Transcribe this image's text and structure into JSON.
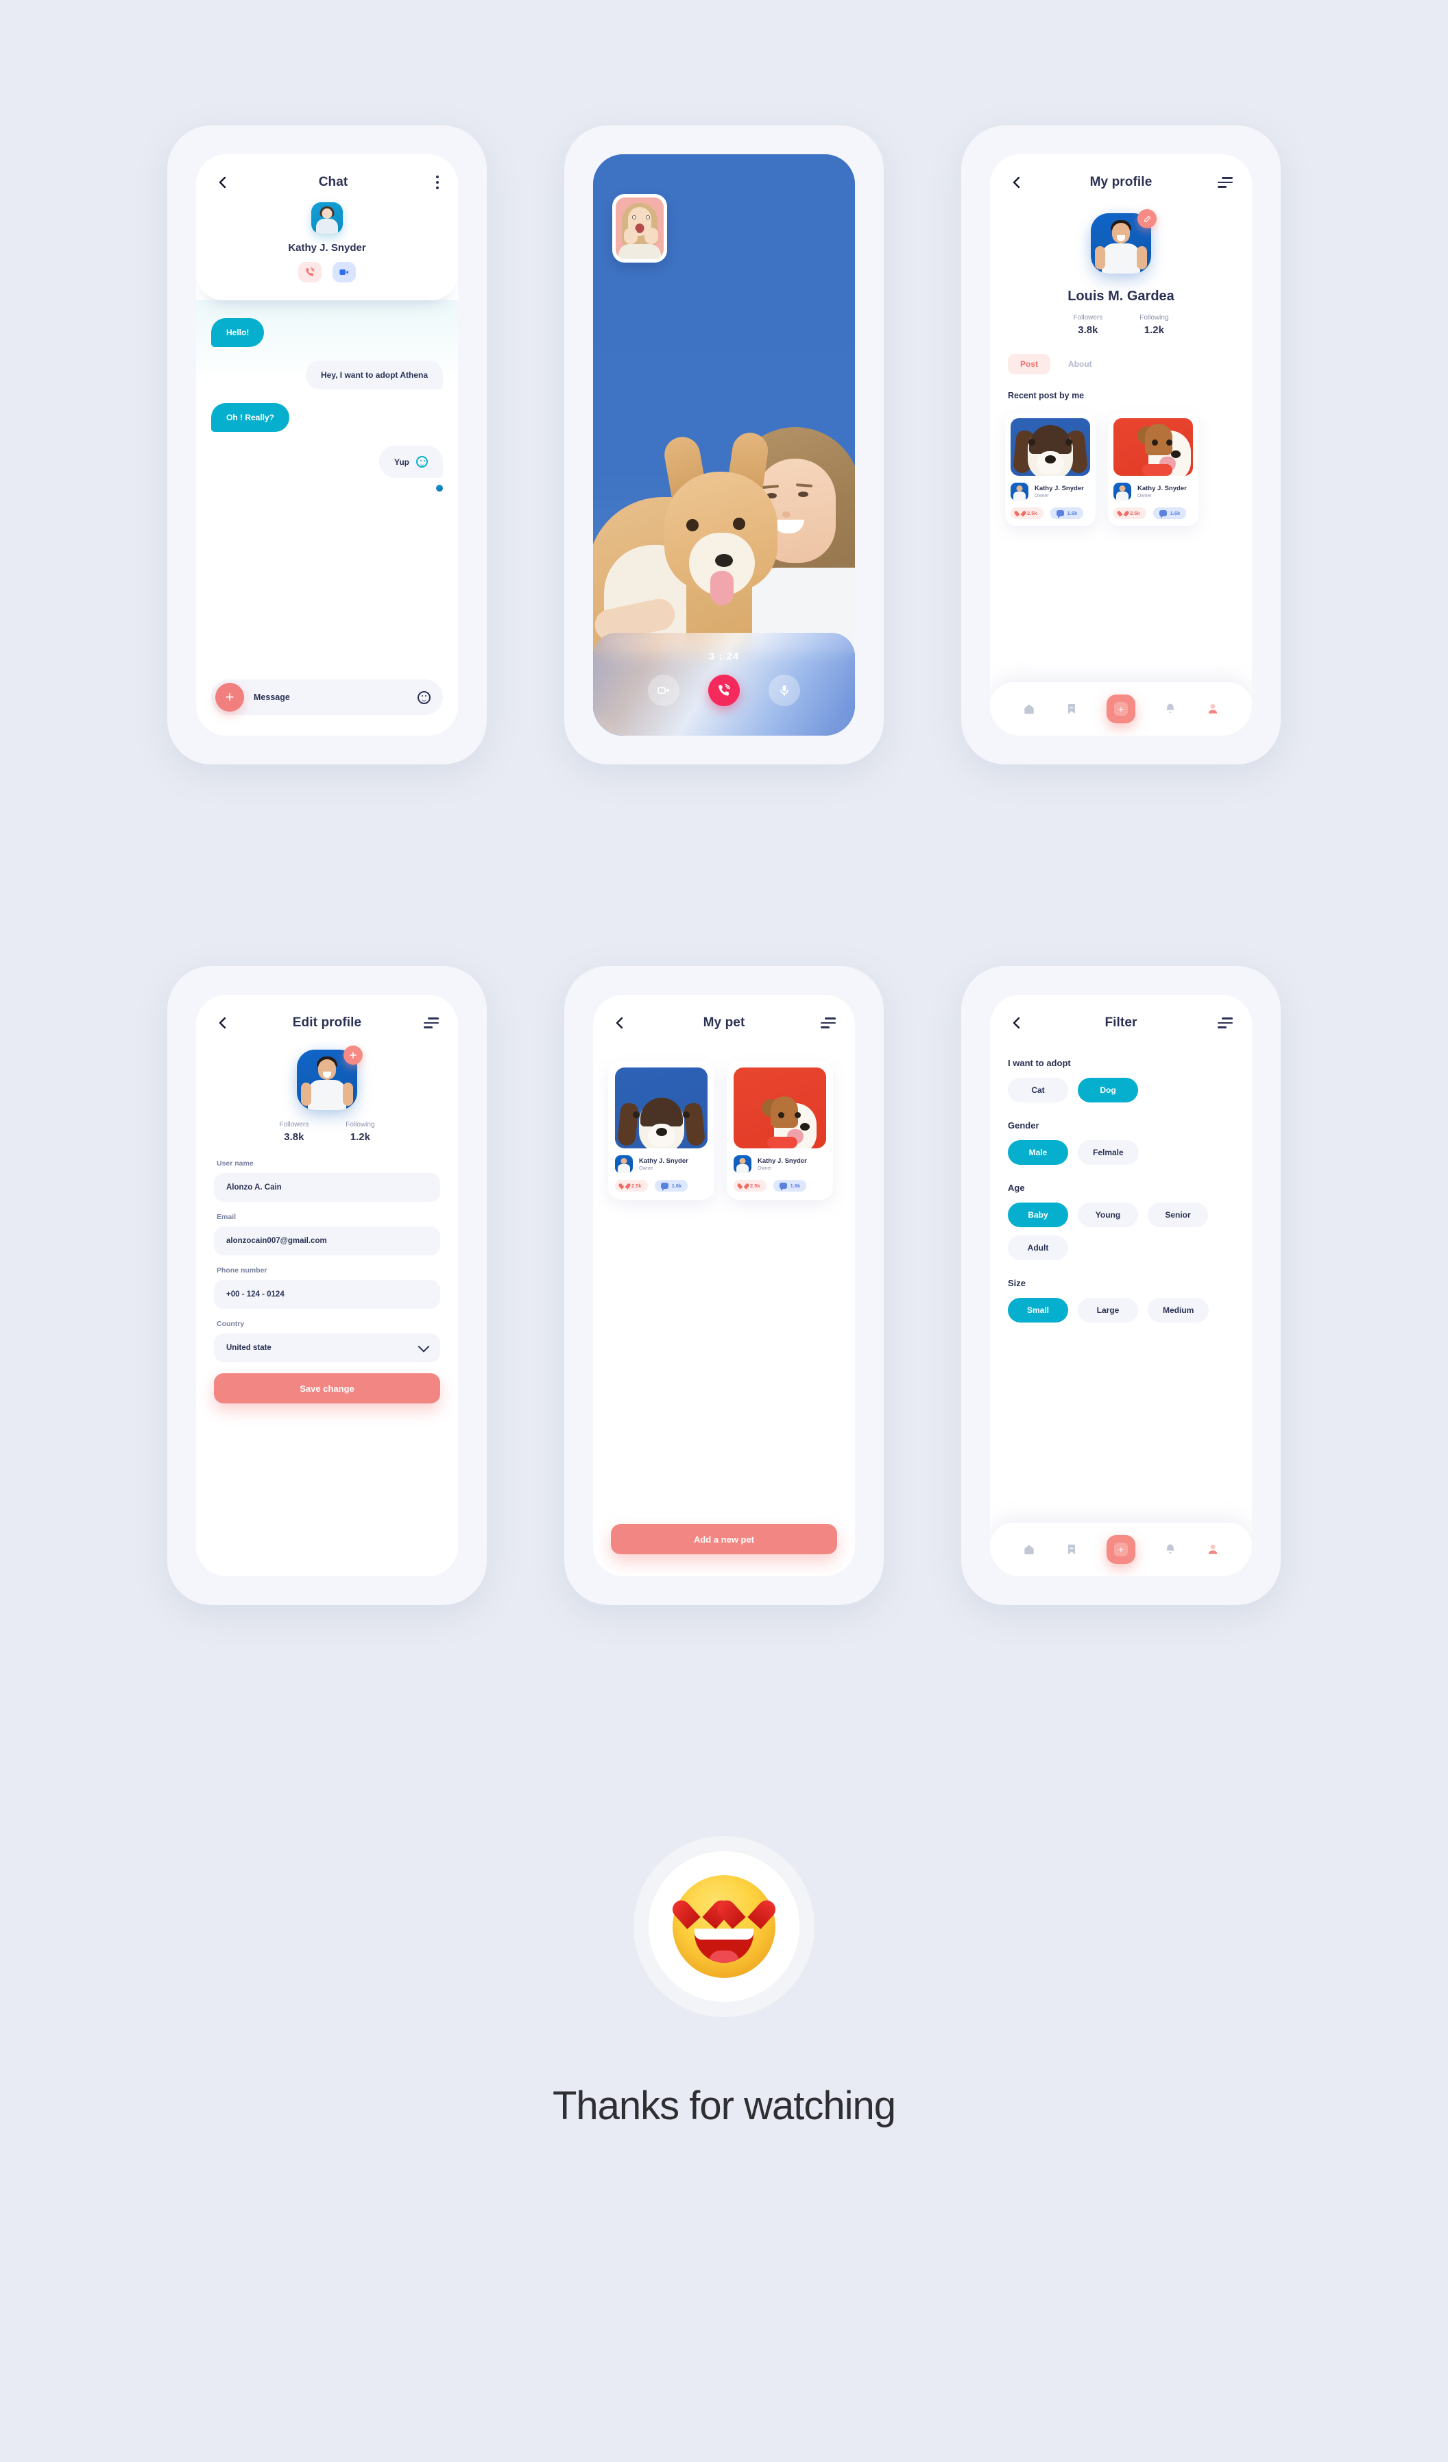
{
  "meta": {
    "footer_text": "Thanks for watching",
    "emoji": "heart-eyes-emoji"
  },
  "chat_screen": {
    "title": "Chat",
    "back_icon": "chevron-left-icon",
    "more_icon": "more-vertical-icon",
    "contact_name": "Kathy J. Snyder",
    "call_icon": "phone-call-icon",
    "video_icon": "video-camera-icon",
    "messages": [
      {
        "text": "Hello!",
        "side": "out"
      },
      {
        "text": "Hey, I want to adopt Athena",
        "side": "in"
      },
      {
        "text": "Oh ! Really?",
        "side": "out"
      },
      {
        "text": "Yup",
        "side": "in",
        "emoji": "smiley-icon"
      }
    ],
    "input_placeholder": "Message",
    "attach_icon": "plus-icon",
    "emoji_icon": "smiley-icon"
  },
  "video_call_screen": {
    "timer": "3 : 24",
    "pip_label": "self-view",
    "controls": [
      {
        "name": "video-toggle-button",
        "icon": "video-camera-icon"
      },
      {
        "name": "end-call-button",
        "icon": "phone-hangup-icon"
      },
      {
        "name": "mic-toggle-button",
        "icon": "microphone-icon"
      }
    ]
  },
  "profile_screen": {
    "title": "My profile",
    "back_icon": "chevron-left-icon",
    "menu_icon": "filter-slider-icon",
    "edit_badge_icon": "pencil-icon",
    "name": "Louis M. Gardea",
    "stats": [
      {
        "label": "Followers",
        "value": "3.8k"
      },
      {
        "label": "Following",
        "value": "1.2k"
      }
    ],
    "tabs": [
      {
        "label": "Post",
        "active": true
      },
      {
        "label": "About",
        "active": false
      }
    ],
    "section_title": "Recent post by me",
    "posts": [
      {
        "owner": "Kathy J. Snyder",
        "role": "Owner",
        "likes": "2.5k",
        "comments": "1.6k",
        "bg": "blue"
      },
      {
        "owner": "Kathy J. Snyder",
        "role": "Owner",
        "likes": "2.5k",
        "comments": "1.6k",
        "bg": "red"
      }
    ]
  },
  "edit_profile_screen": {
    "title": "Edit profile",
    "back_icon": "chevron-left-icon",
    "menu_icon": "filter-slider-icon",
    "add_badge_icon": "plus-icon",
    "stats": [
      {
        "label": "Followers",
        "value": "3.8k"
      },
      {
        "label": "Following",
        "value": "1.2k"
      }
    ],
    "fields": [
      {
        "label": "User name",
        "value": "Alonzo A. Cain",
        "type": "text"
      },
      {
        "label": "Email",
        "value": "alonzocain007@gmail.com",
        "type": "text"
      },
      {
        "label": "Phone number",
        "value": "+00 - 124 - 0124",
        "type": "text"
      },
      {
        "label": "Country",
        "value": "United state",
        "type": "select"
      }
    ],
    "save_label": "Save change"
  },
  "my_pet_screen": {
    "title": "My pet",
    "back_icon": "chevron-left-icon",
    "menu_icon": "filter-slider-icon",
    "pets": [
      {
        "owner": "Kathy J. Snyder",
        "role": "Owner",
        "likes": "2.5k",
        "comments": "1.6k",
        "bg": "blue"
      },
      {
        "owner": "Kathy J. Snyder",
        "role": "Owner",
        "likes": "2.5k",
        "comments": "1.6k",
        "bg": "red"
      }
    ],
    "add_label": "Add a new pet"
  },
  "filter_screen": {
    "title": "Filter",
    "back_icon": "chevron-left-icon",
    "menu_icon": "filter-slider-icon",
    "groups": [
      {
        "title": "I want to adopt",
        "options": [
          {
            "label": "Cat",
            "selected": false
          },
          {
            "label": "Dog",
            "selected": true
          }
        ]
      },
      {
        "title": "Gender",
        "options": [
          {
            "label": "Male",
            "selected": true
          },
          {
            "label": "Felmale",
            "selected": false
          }
        ]
      },
      {
        "title": "Age",
        "options": [
          {
            "label": "Baby",
            "selected": true
          },
          {
            "label": "Young",
            "selected": false
          },
          {
            "label": "Senior",
            "selected": false
          },
          {
            "label": "Adult",
            "selected": false
          }
        ]
      },
      {
        "title": "Size",
        "options": [
          {
            "label": "Small",
            "selected": true
          },
          {
            "label": "Large",
            "selected": false
          },
          {
            "label": "Medium",
            "selected": false
          }
        ]
      }
    ]
  },
  "bottom_nav": {
    "items": [
      {
        "name": "home",
        "icon": "home-icon"
      },
      {
        "name": "bookmarks",
        "icon": "bookmark-icon"
      },
      {
        "name": "add",
        "icon": "plus-icon"
      },
      {
        "name": "notifications",
        "icon": "bell-icon"
      },
      {
        "name": "profile",
        "icon": "person-icon"
      }
    ]
  },
  "colors": {
    "accent_teal": "#06AFCD",
    "accent_coral": "#F28682",
    "text_dark": "#2B3153",
    "bg": "#E8EBF3"
  }
}
